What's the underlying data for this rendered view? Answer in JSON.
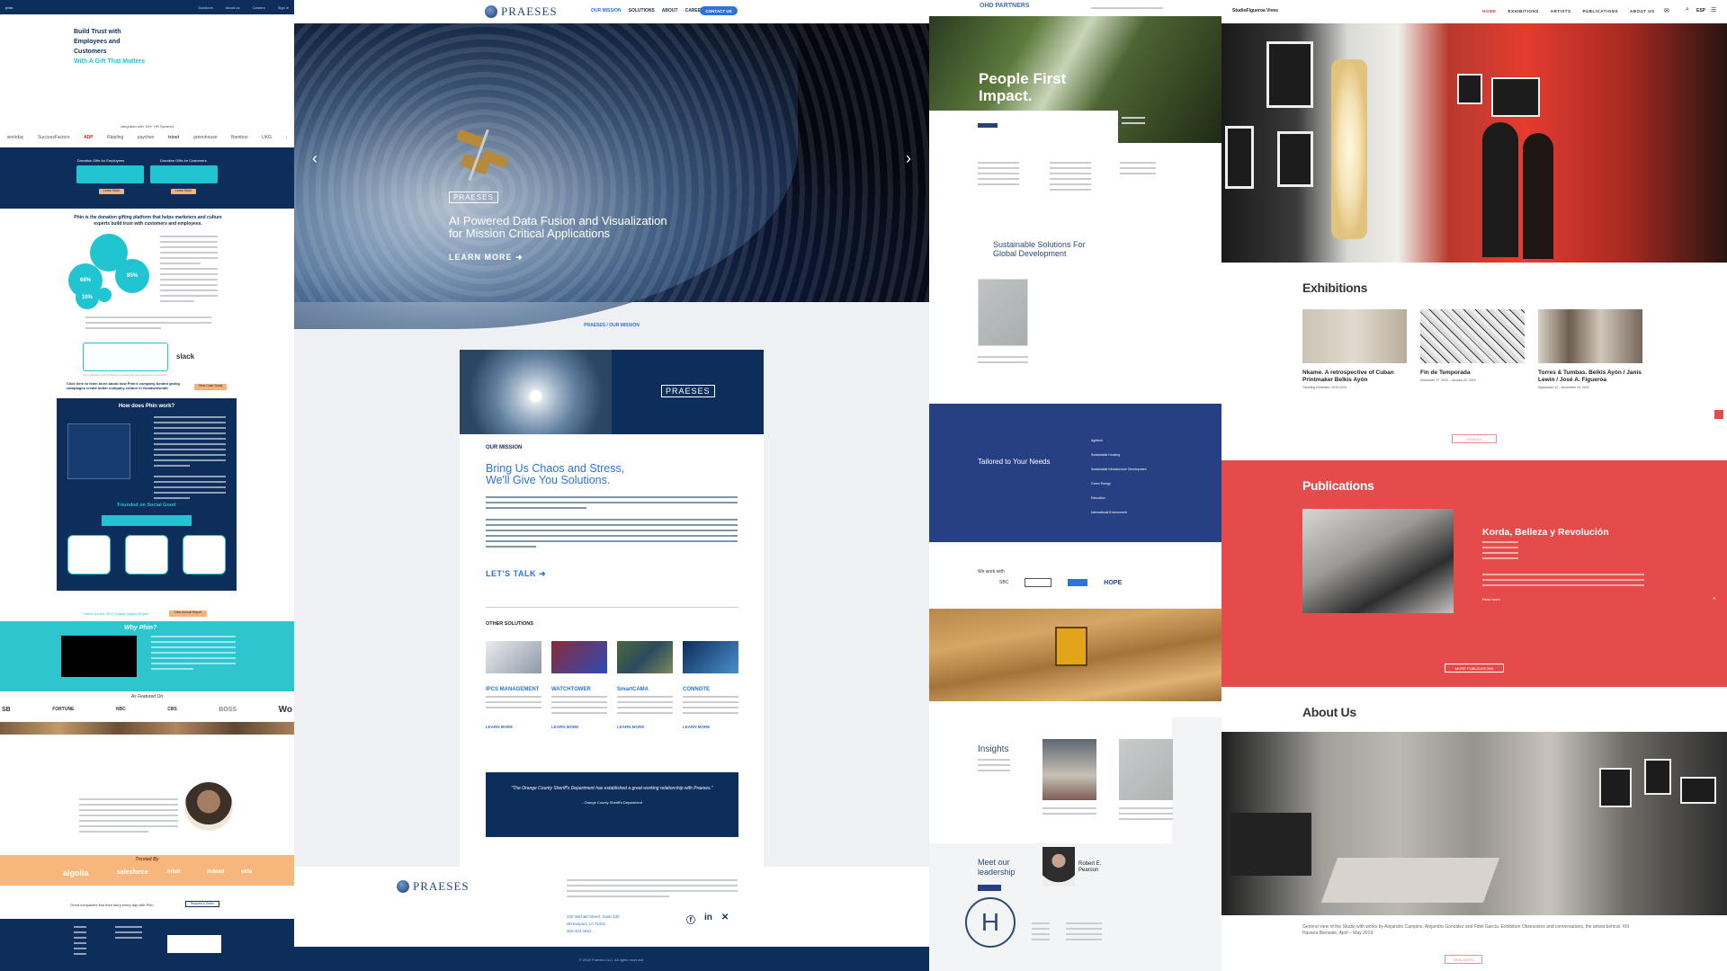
{
  "panel1": {
    "nav": {
      "logo": "phin",
      "links": [
        "Solutions",
        "About us",
        "Careers",
        "Sign in"
      ]
    },
    "hero": {
      "line1": "Build Trust with",
      "line2": "Employees and",
      "line3": "Customers",
      "tagline": "With A Gift That Matters"
    },
    "logobar_caption": "Integrated with 100+ HR Systems",
    "partner_logos": [
      "workday",
      "SuccessFactors",
      "ADP",
      "Rippling",
      "paychex",
      "trinet",
      "greenhouse",
      "Bamboo",
      "UKG"
    ],
    "blue_boxes": [
      {
        "title": "Donation Gifts for Employees",
        "button": "Learn More"
      },
      {
        "title": "Donation Gifts for Customers",
        "button": "Learn More"
      }
    ],
    "intro": "Phin is the donation gifting platform that helps marketers and culture experts build trust with customers and employees.",
    "stats": [
      "68%",
      "85%",
      "10%"
    ],
    "slack": "slack",
    "slack_caption": "Phin's Reward App for Slack to seamlessly give employees recognition",
    "study_cta": "Click here to learn more about how Phin's company-funded giving campaigns create better company culture in Goodwinsmith",
    "study_button": "View Case Study",
    "how": {
      "title": "How does Phin work?",
      "founded": "Founded on Social Good"
    },
    "report_cta": "Check out the 2023 Global Impact Report",
    "report_button": "View Annual Report",
    "why": "Why Phin?",
    "featured_title": "As Featured On",
    "featured": [
      "SB",
      "FORTUNE",
      "NBC",
      "CBS",
      "BOSS",
      "Wo"
    ],
    "trusted_title": "Trusted By",
    "trusted": [
      "algolia",
      "salesforce",
      "Intuit",
      "Indeed",
      "okta"
    ],
    "footer_cta": "Great companies find their story every day with Phin.",
    "footer_button": "Request A Demo"
  },
  "panel2": {
    "logo": "PRAESES",
    "menu": [
      "OUR MISSION",
      "SOLUTIONS",
      "ABOUT",
      "CAREERS"
    ],
    "contact": "CONTACT US",
    "hero": {
      "tag": "PRAESES",
      "title_line1": "AI Powered Data Fusion and Visualization",
      "title_line2": "for Mission Critical Applications",
      "cta": "LEARN MORE"
    },
    "breadcrumb": "PRAESES / OUR MISSION",
    "mission_tag": "PRAESES",
    "mission_label": "OUR MISSION",
    "mission_title1": "Bring Us Chaos and Stress,",
    "mission_title2": "We'll Give You Solutions.",
    "lets_talk": "LET'S TALK",
    "other": "OTHER SOLUTIONS",
    "solutions": [
      {
        "name": "IPCS MANAGEMENT",
        "cta": "LEARN MORE"
      },
      {
        "name": "WATCHTOWER",
        "cta": "LEARN MORE"
      },
      {
        "name": "SmartCAMA",
        "cta": "LEARN MORE"
      },
      {
        "name": "CONNOTE",
        "cta": "LEARN MORE"
      }
    ],
    "quote": "\"The Orange County Sheriff's Department has established a great working relationship with Praeses.\"",
    "quote_by": "- Orange County Sheriff's Department",
    "footer_logo": "PRAESES",
    "address": "100 Wichatt Street, Suite 100",
    "city": "Shreveport, LA 71101",
    "phone": "318.424.4424",
    "copyright": "© 2024 Praeses LLC. All rights reserved."
  },
  "panel3": {
    "logo": "OHD PARTNERS",
    "hero": {
      "line1": "People First",
      "line2": "Impact."
    },
    "sustainable1": "Sustainable Solutions For",
    "sustainable2": "Global Development",
    "tailored": "Tailored to Your Needs",
    "services": [
      "Agritech",
      "Sustainable Housing",
      "Sustainable Infrastructure Development",
      "Green Energy",
      "Education",
      "International Environment"
    ],
    "we_work": "We work with",
    "partners": [
      "SBC",
      "HOPE"
    ],
    "insights": "Insights",
    "meet": "Meet our",
    "leadership": "leadership",
    "ceo": "Robert E. Pearson"
  },
  "panel4": {
    "logo": "StudioFigueroa Vives",
    "menu": [
      "HOME",
      "EXHIBITIONS",
      "ARTISTS",
      "PUBLICATIONS",
      "ABOUT US"
    ],
    "lang": "ESP",
    "exhibitions_title": "Exhibitions",
    "exhibitions": [
      {
        "title": "Nkame. A retrospective of Cuban Printmaker Belkis Ayón",
        "date": "Traveling Exhibition, 2019-2024"
      },
      {
        "title": "Fin de Temporada",
        "date": "November 17, 2023 – January 20, 2024"
      },
      {
        "title": "Torres & Tumbas. Belkis Ayón / Janis Lewin / José A. Figueroa",
        "date": "September 14 – November 15, 2023"
      }
    ],
    "view_all": "VIEW ALL",
    "publications_title": "Publications",
    "pub_title": "Korda, Belleza y Revolución",
    "pub_link": "Read more",
    "more_pubs": "MORE PUBLICATIONS",
    "about_title": "About Us",
    "about_caption": "General view of the Studio with works by Alejandro Campins, Alejandro González and Fidel García. Exhibition Obsessions and conversations, the artists behind. XIII Havana Biennale, April – May 2019.",
    "view_more": "VIEW MORE"
  }
}
